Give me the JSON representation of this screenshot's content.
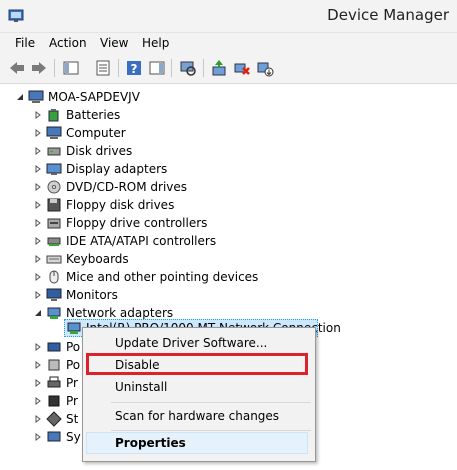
{
  "window": {
    "title": "Device Manager"
  },
  "menubar": {
    "file": "File",
    "action": "Action",
    "view": "View",
    "help": "Help"
  },
  "tree": {
    "root": "MOA-SAPDEVJV",
    "items": [
      {
        "label": "Batteries",
        "icon": "battery-icon"
      },
      {
        "label": "Computer",
        "icon": "computer-icon"
      },
      {
        "label": "Disk drives",
        "icon": "disk-drive-icon"
      },
      {
        "label": "Display adapters",
        "icon": "display-adapter-icon"
      },
      {
        "label": "DVD/CD-ROM drives",
        "icon": "dvd-drive-icon"
      },
      {
        "label": "Floppy disk drives",
        "icon": "floppy-disk-icon"
      },
      {
        "label": "Floppy drive controllers",
        "icon": "floppy-controller-icon"
      },
      {
        "label": "IDE ATA/ATAPI controllers",
        "icon": "ide-controller-icon"
      },
      {
        "label": "Keyboards",
        "icon": "keyboard-icon"
      },
      {
        "label": "Mice and other pointing devices",
        "icon": "mouse-icon"
      },
      {
        "label": "Monitors",
        "icon": "monitor-icon"
      },
      {
        "label": "Network adapters",
        "icon": "network-adapter-icon"
      }
    ],
    "network_child": "Intel(R) PRO/1000 MT Network Connection",
    "partial_items": [
      "Po",
      "Po",
      "Pr",
      "Pr",
      "St",
      "Sy"
    ]
  },
  "context_menu": {
    "update_driver": "Update Driver Software...",
    "disable": "Disable",
    "uninstall": "Uninstall",
    "scan": "Scan for hardware changes",
    "properties": "Properties"
  },
  "colors": {
    "highlight_border": "#e0202a",
    "selection": "#cce8ff"
  }
}
